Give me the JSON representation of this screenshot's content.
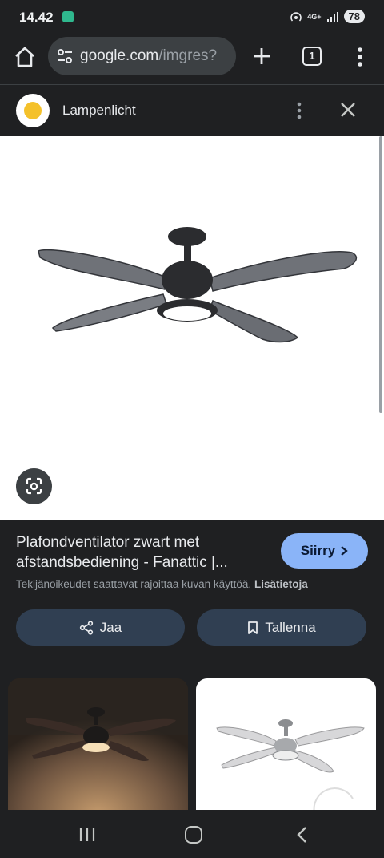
{
  "status_bar": {
    "time": "14.42",
    "network": "4G+",
    "battery": "78"
  },
  "address_bar": {
    "url_host": "google.com",
    "url_path": "/imgres?",
    "tab_count": "1"
  },
  "sheet": {
    "site_name": "Lampenlicht",
    "site_logo_color": "#f4c12b"
  },
  "result": {
    "title": "Plafondventilator zwart met afstandsbediening - Fanattic |...",
    "visit_label": "Siirry",
    "copyright_text": "Tekijänoikeudet saattavat rajoittaa kuvan käyttöä.",
    "more_info_label": "Lisätietoja",
    "share_label": "Jaa",
    "save_label": "Tallenna"
  },
  "colors": {
    "background": "#1f2022",
    "accent": "#8ab4f8",
    "button_bg": "#303f52"
  },
  "icons": {
    "home": "home-icon",
    "site_settings": "tune-icon",
    "new_tab": "plus-icon",
    "tabs": "tab-switcher-icon",
    "menu": "more-vert-icon",
    "close": "close-icon",
    "lens": "google-lens-icon",
    "share": "share-icon",
    "bookmark": "bookmark-icon"
  }
}
